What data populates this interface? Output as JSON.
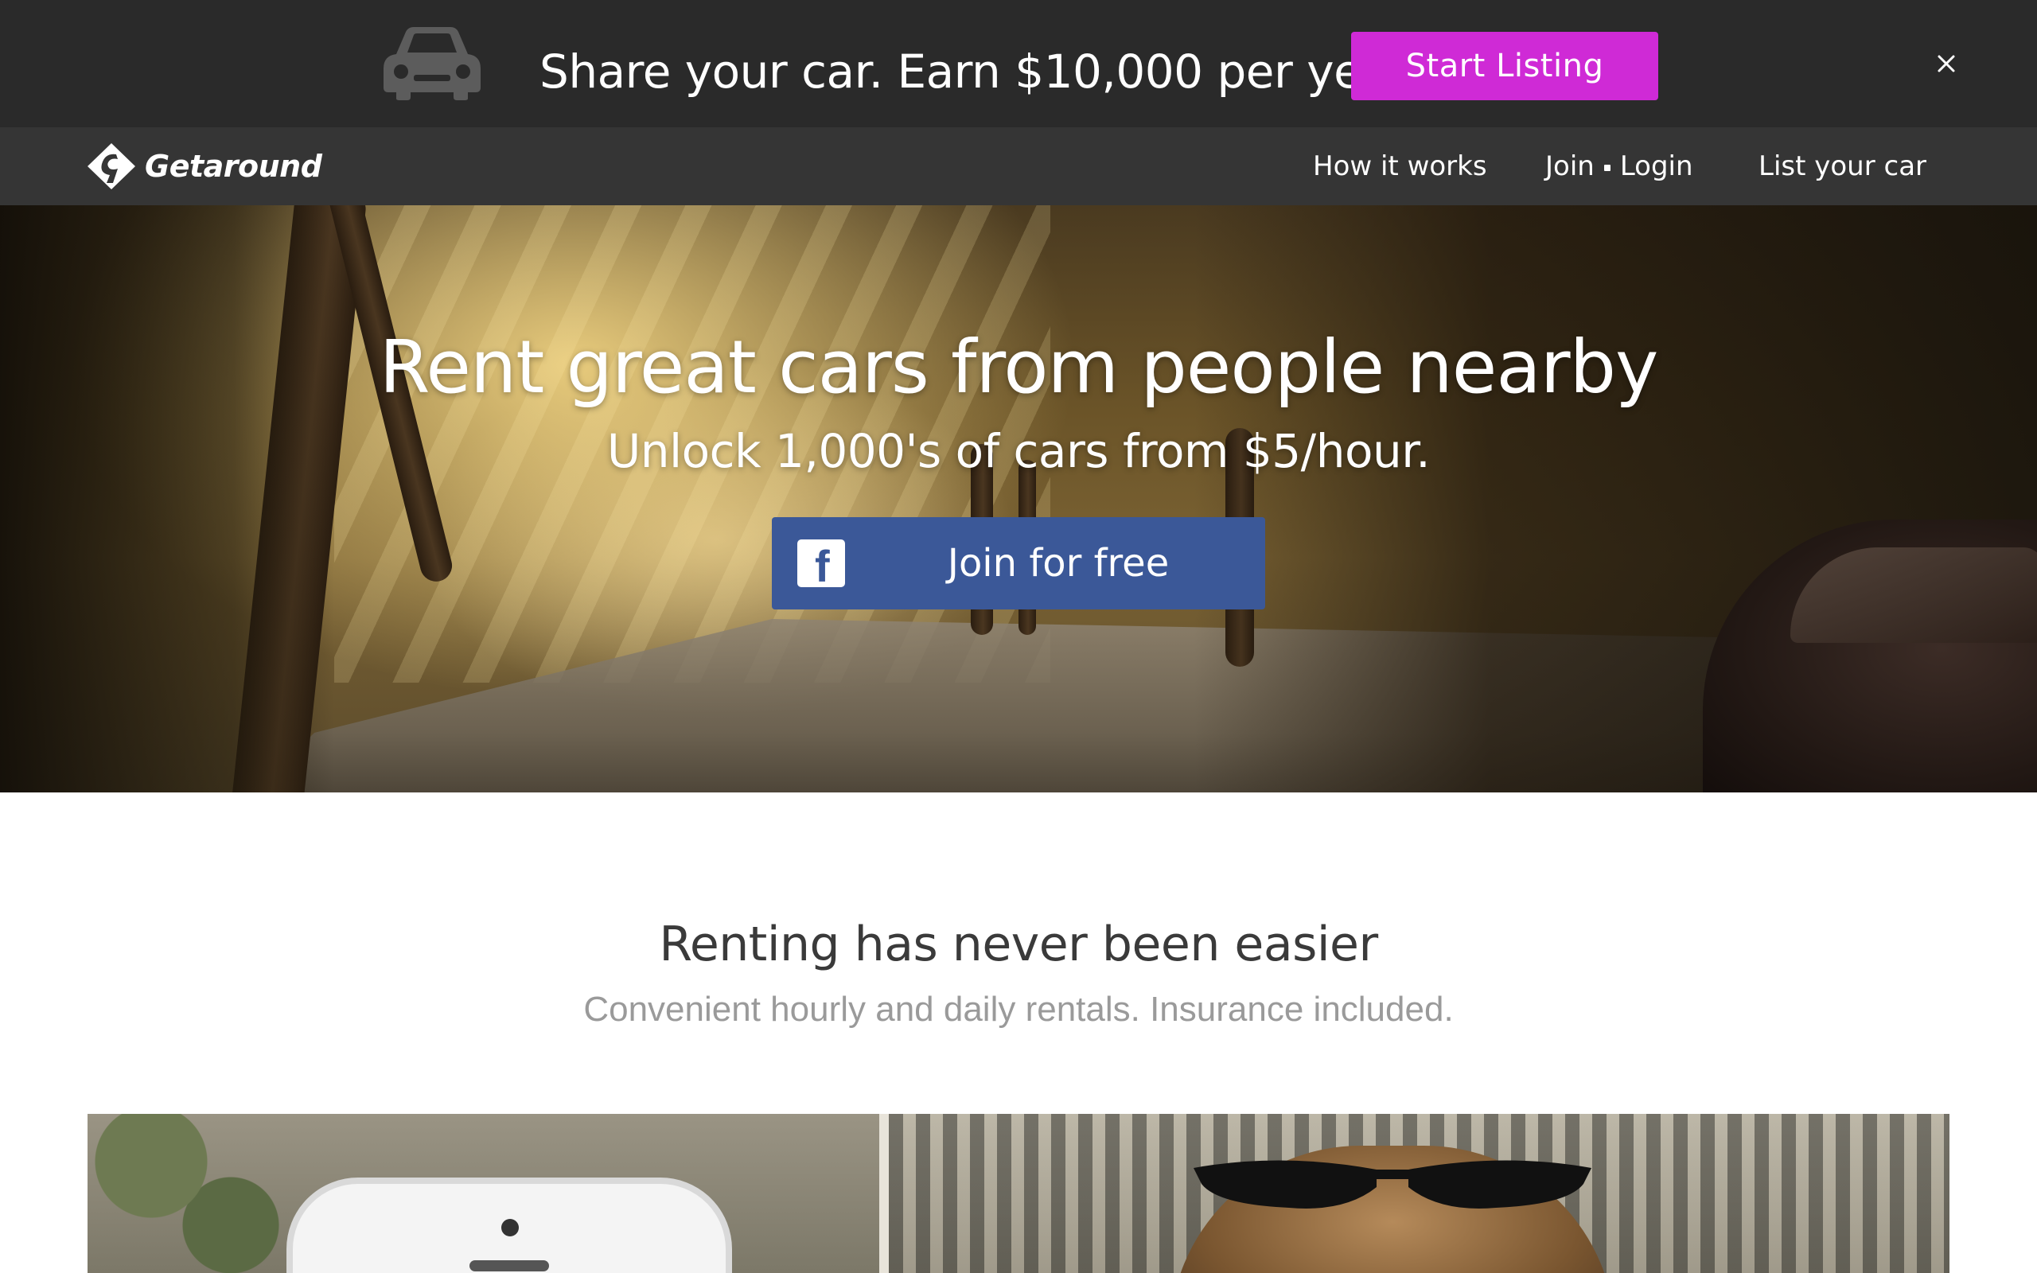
{
  "promo": {
    "text": "Share your car. Earn $10,000 per year.",
    "cta_label": "Start Listing",
    "close_glyph": "×",
    "icons": [
      "car-icon",
      "close-icon"
    ],
    "cta_color": "#cf2ad6",
    "background": "#2a2a2a"
  },
  "nav": {
    "logo_text": "Getaround",
    "links": {
      "how": "How it works",
      "join": "Join",
      "login": "Login",
      "list": "List your car"
    },
    "background": "#353535"
  },
  "hero": {
    "title": "Rent great cars from people nearby",
    "subtitle": "Unlock 1,000's of cars from $5/hour.",
    "cta_label": "Join for free",
    "cta_icon": "facebook-icon",
    "cta_color": "#3b5898"
  },
  "section": {
    "title": "Renting has never been easier",
    "subtitle": "Convenient hourly and daily rentals. Insurance included."
  }
}
